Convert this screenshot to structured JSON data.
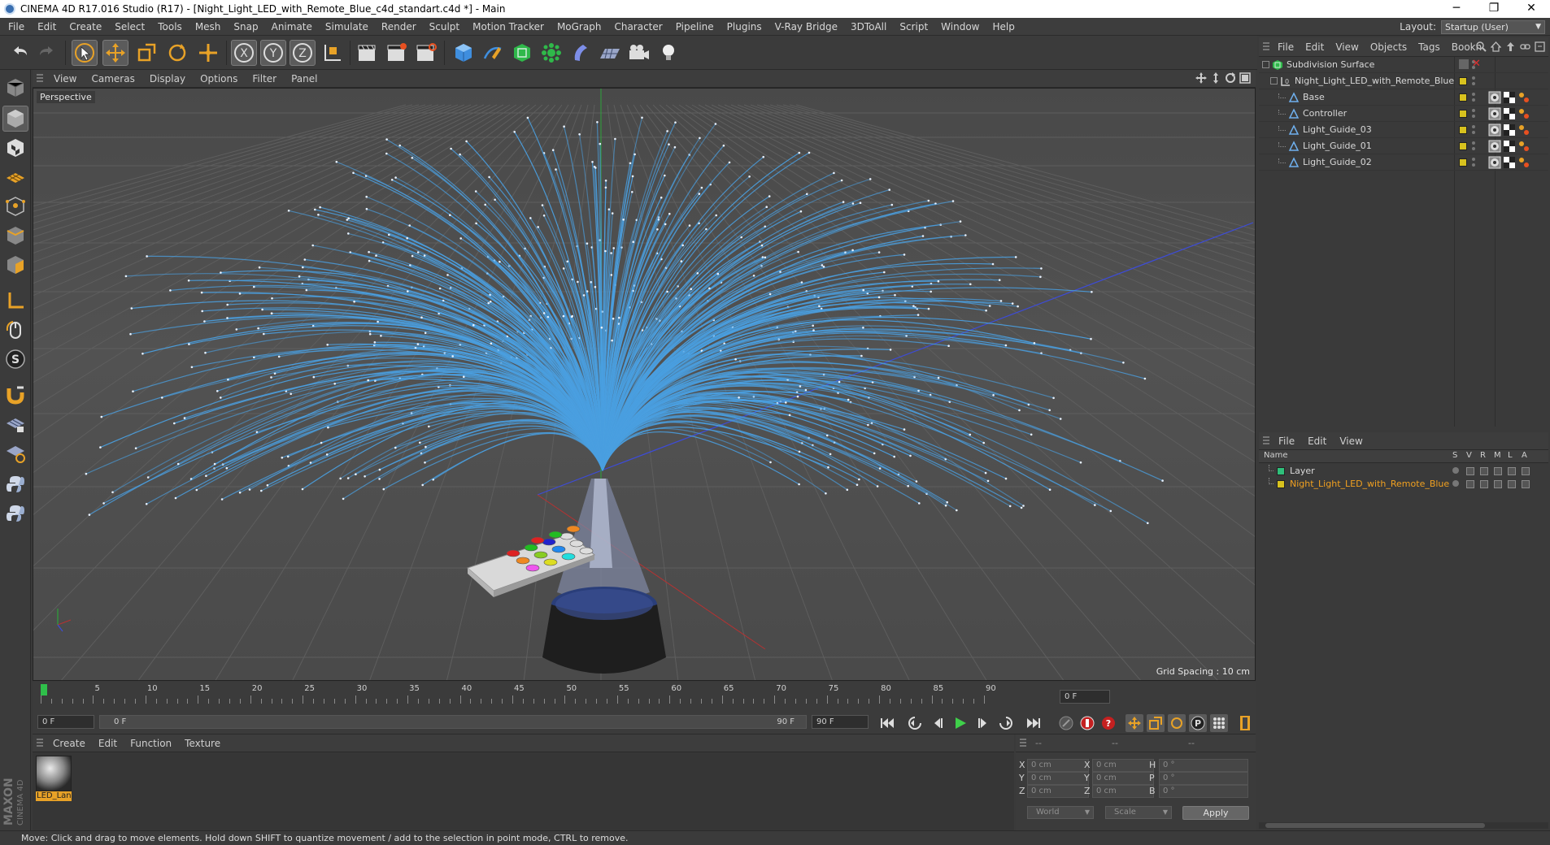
{
  "window": {
    "title": "CINEMA 4D R17.016 Studio (R17) - [Night_Light_LED_with_Remote_Blue_c4d_standart.c4d *] - Main",
    "minimize": "─",
    "restore": "❐",
    "close": "✕"
  },
  "menubar": {
    "items": [
      "File",
      "Edit",
      "Create",
      "Select",
      "Tools",
      "Mesh",
      "Snap",
      "Animate",
      "Simulate",
      "Render",
      "Sculpt",
      "Motion Tracker",
      "MoGraph",
      "Character",
      "Pipeline",
      "Plugins",
      "V-Ray Bridge",
      "3DToAll",
      "Script",
      "Window",
      "Help"
    ],
    "layout_label": "Layout:",
    "layout_value": "Startup (User)"
  },
  "viewport": {
    "menu": [
      "View",
      "Cameras",
      "Display",
      "Options",
      "Filter",
      "Panel"
    ],
    "label": "Perspective",
    "grid_spacing": "Grid Spacing : 10 cm"
  },
  "timeline": {
    "ticks": [
      "0",
      "5",
      "10",
      "15",
      "20",
      "25",
      "30",
      "35",
      "40",
      "45",
      "50",
      "55",
      "60",
      "65",
      "70",
      "75",
      "80",
      "85",
      "90"
    ],
    "current_frame": "0 F",
    "start_field": "0 F",
    "range_start": "0 F",
    "range_end": "90 F",
    "end_field": "90 F",
    "playhead_frame": 0,
    "max_frame": 90
  },
  "material_manager": {
    "menu": [
      "Create",
      "Edit",
      "Function",
      "Texture"
    ],
    "materials": [
      {
        "name": "LED_Lan"
      }
    ]
  },
  "coordinates": {
    "headers": [
      "--",
      "--",
      "--"
    ],
    "rows": [
      {
        "a_label": "X",
        "a_value": "0 cm",
        "b_label": "X",
        "b_value": "0 cm",
        "c_label": "H",
        "c_value": "0 °"
      },
      {
        "a_label": "Y",
        "a_value": "0 cm",
        "b_label": "Y",
        "b_value": "0 cm",
        "c_label": "P",
        "c_value": "0 °"
      },
      {
        "a_label": "Z",
        "a_value": "0 cm",
        "b_label": "Z",
        "b_value": "0 cm",
        "c_label": "B",
        "c_value": "0 °"
      }
    ],
    "space_dropdown": "World",
    "mode_dropdown": "Scale",
    "apply": "Apply"
  },
  "object_manager": {
    "menu": [
      "File",
      "Edit",
      "View",
      "Objects",
      "Tags",
      "Bookn"
    ],
    "objects": [
      {
        "name": "Subdivision Surface",
        "depth": 0
      },
      {
        "name": "Night_Light_LED_with_Remote_Blue",
        "depth": 1
      },
      {
        "name": "Base",
        "depth": 2
      },
      {
        "name": "Controller",
        "depth": 2
      },
      {
        "name": "Light_Guide_03",
        "depth": 2
      },
      {
        "name": "Light_Guide_01",
        "depth": 2
      },
      {
        "name": "Light_Guide_02",
        "depth": 2
      }
    ]
  },
  "layer_manager": {
    "menu": [
      "File",
      "Edit",
      "View"
    ],
    "columns": {
      "name": "Name",
      "s": "S",
      "v": "V",
      "r": "R",
      "m": "M",
      "l": "L",
      "a": "A"
    },
    "layers": [
      {
        "name": "Layer",
        "color": "#2fbf7a"
      },
      {
        "name": "Night_Light_LED_with_Remote_Blue",
        "color": "#d8c21e"
      }
    ]
  },
  "status": {
    "text": "Move: Click and drag to move elements. Hold down SHIFT to quantize movement / add to the selection in point mode, CTRL to remove."
  },
  "colors": {
    "accent": "#e8a227",
    "fiber": "#4a9fe0",
    "selected_text": "#f0a020"
  },
  "icons": {
    "logo": "cinema4d-logo-icon",
    "text_glyph": "S"
  }
}
